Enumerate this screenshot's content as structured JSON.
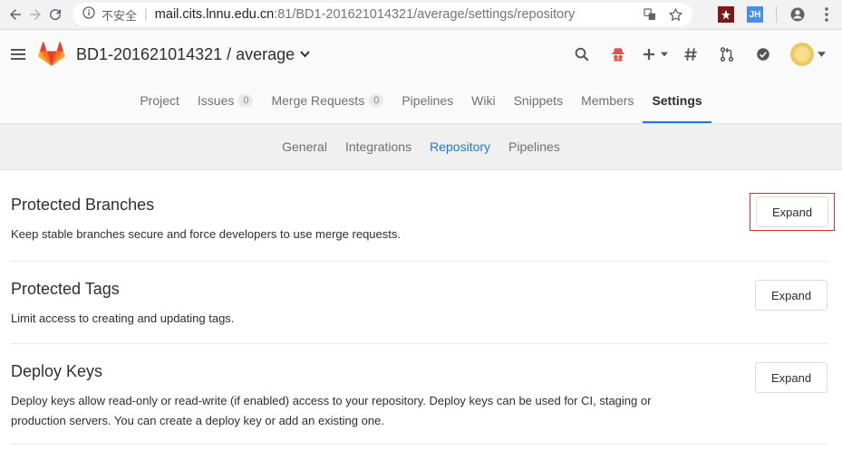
{
  "browser": {
    "insecure_label": "不安全",
    "url_host": "mail.cits.lnnu.edu.cn",
    "url_rest": ":81/BD1-201621014321/average/settings/repository",
    "ext_jh": "JH"
  },
  "header": {
    "project_title": "BD1-201621014321 / average"
  },
  "nav": {
    "tabs": [
      {
        "label": "Project"
      },
      {
        "label": "Issues",
        "count": "0"
      },
      {
        "label": "Merge Requests",
        "count": "0"
      },
      {
        "label": "Pipelines"
      },
      {
        "label": "Wiki"
      },
      {
        "label": "Snippets"
      },
      {
        "label": "Members"
      },
      {
        "label": "Settings"
      }
    ]
  },
  "subnav": {
    "items": [
      {
        "label": "General"
      },
      {
        "label": "Integrations"
      },
      {
        "label": "Repository"
      },
      {
        "label": "Pipelines"
      }
    ]
  },
  "sections": [
    {
      "title": "Protected Branches",
      "description": "Keep stable branches secure and force developers to use merge requests.",
      "button": "Expand"
    },
    {
      "title": "Protected Tags",
      "description": "Limit access to creating and updating tags.",
      "button": "Expand"
    },
    {
      "title": "Deploy Keys",
      "description_line1": "Deploy keys allow read-only or read-write (if enabled) access to your repository. Deploy keys can be used for CI, staging or",
      "description_line2": "production servers. You can create a deploy key or add an existing one.",
      "button": "Expand"
    }
  ],
  "colors": {
    "accent": "#1f78d1",
    "highlight": "#cc3333"
  }
}
